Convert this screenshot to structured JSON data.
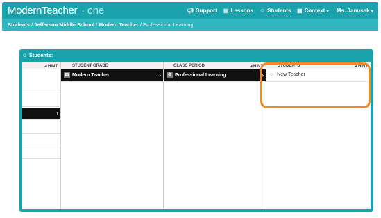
{
  "app": {
    "logo_main": "ModernTeacher",
    "logo_suffix": "one"
  },
  "topnav": {
    "support": "Support",
    "lessons": "Lessons",
    "students": "Students",
    "context": "Context",
    "user": "Ms. Janusek"
  },
  "breadcrumb": {
    "part1": "Students",
    "sep": "/",
    "part2": "Jefferson Middle School",
    "part3": "Modern Teacher",
    "part4": "Professional Learning"
  },
  "panel": {
    "title": "Students:"
  },
  "columns": [
    {
      "header": "",
      "hint": "HINT"
    },
    {
      "header": "STUDENT GRADE",
      "hint": "",
      "items": [
        "Modern Teacher"
      ]
    },
    {
      "header": "CLASS PERIOD",
      "hint": "HINT",
      "items": [
        "Professional Learning"
      ]
    },
    {
      "header": "STUDENTS",
      "hint": "HINT",
      "items": [
        "New Teacher"
      ]
    }
  ],
  "colors": {
    "brand": "#1ba3ad",
    "highlight": "#f08a24"
  }
}
